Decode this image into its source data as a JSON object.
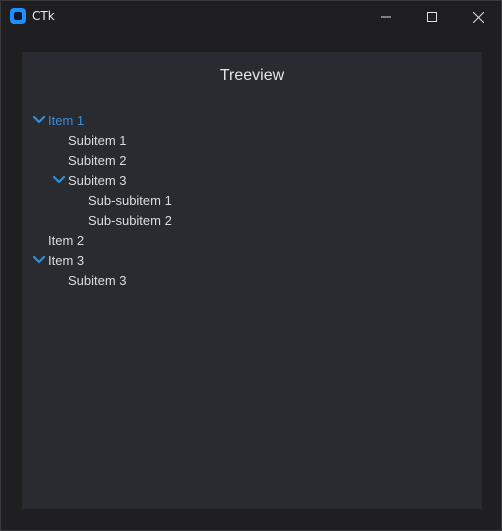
{
  "window": {
    "title": "CTk",
    "icon": "ctk-app-icon"
  },
  "titlebar_buttons": {
    "minimize": "minimize-icon",
    "maximize": "maximize-icon",
    "close": "close-icon"
  },
  "panel": {
    "title": "Treeview"
  },
  "tree": {
    "items": [
      {
        "label": "Item 1",
        "level": 0,
        "expanded": true,
        "selected": true
      },
      {
        "label": "Subitem 1",
        "level": 1
      },
      {
        "label": "Subitem 2",
        "level": 1
      },
      {
        "label": "Subitem 3",
        "level": 1,
        "expanded": true
      },
      {
        "label": "Sub-subitem 1",
        "level": 2
      },
      {
        "label": "Sub-subitem 2",
        "level": 2
      },
      {
        "label": "Item 2",
        "level": 0
      },
      {
        "label": "Item 3",
        "level": 0,
        "expanded": true
      },
      {
        "label": "Subitem 3",
        "level": 1
      }
    ]
  },
  "colors": {
    "accent": "#3b8ed6",
    "chevron": "#2f8fdc",
    "panel_bg": "#2a2b30",
    "window_bg": "#1f1f21"
  }
}
